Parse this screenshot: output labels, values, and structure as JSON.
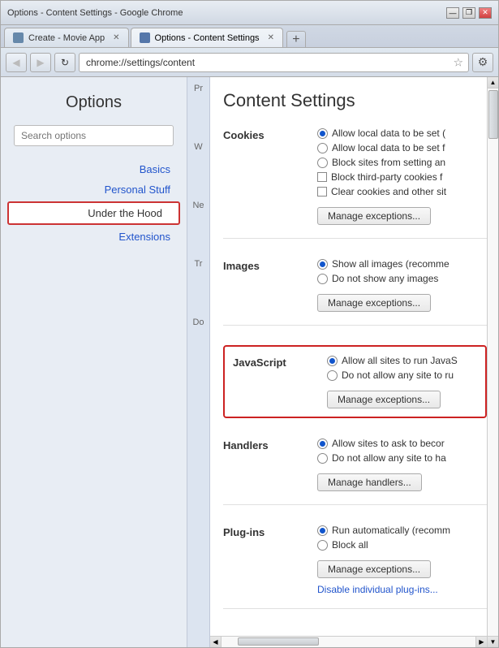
{
  "browser": {
    "tabs": [
      {
        "id": "tab1",
        "title": "Create - Movie App",
        "active": false,
        "icon": "movie-icon"
      },
      {
        "id": "tab2",
        "title": "Options - Content Settings",
        "active": true,
        "icon": "settings-icon"
      }
    ],
    "new_tab_label": "+",
    "address": "chrome://settings/content",
    "nav_back": "◀",
    "nav_forward": "▶",
    "nav_refresh": "↻",
    "star_icon": "☆",
    "wrench_icon": "🔧",
    "min_btn": "—",
    "restore_btn": "❐",
    "close_btn": "✕",
    "title_bar_title": "Options - Content Settings - Google Chrome"
  },
  "sidebar": {
    "title": "Options",
    "search_placeholder": "Search options",
    "links": [
      {
        "id": "basics",
        "label": "Basics",
        "active": false
      },
      {
        "id": "personal-stuff",
        "label": "Personal Stuff",
        "active": false
      },
      {
        "id": "under-the-hood",
        "label": "Under the Hood",
        "active": true
      },
      {
        "id": "extensions",
        "label": "Extensions",
        "active": false
      }
    ],
    "section_labels": [
      "Pr",
      "W\nCo",
      "Ne",
      "Tr",
      "Do"
    ]
  },
  "content": {
    "title": "Content Settings",
    "sections": [
      {
        "id": "cookies",
        "label": "Cookies",
        "options": [
          {
            "type": "radio",
            "selected": true,
            "text": "Allow local data to be set ("
          },
          {
            "type": "radio",
            "selected": false,
            "text": "Allow local data to be set f"
          },
          {
            "type": "radio",
            "selected": false,
            "text": "Block sites from setting an"
          },
          {
            "type": "checkbox",
            "checked": false,
            "text": "Block third-party cookies f"
          },
          {
            "type": "checkbox",
            "checked": false,
            "text": "Clear cookies and other sit"
          }
        ],
        "button": "Manage exceptions..."
      },
      {
        "id": "images",
        "label": "Images",
        "options": [
          {
            "type": "radio",
            "selected": true,
            "text": "Show all images (recomme"
          },
          {
            "type": "radio",
            "selected": false,
            "text": "Do not show any images"
          }
        ],
        "button": "Manage exceptions..."
      },
      {
        "id": "javascript",
        "label": "JavaScript",
        "highlighted": true,
        "options": [
          {
            "type": "radio",
            "selected": true,
            "text": "Allow all sites to run JavaS"
          },
          {
            "type": "radio",
            "selected": false,
            "text": "Do not allow any site to ru"
          }
        ],
        "button": "Manage exceptions..."
      },
      {
        "id": "handlers",
        "label": "Handlers",
        "options": [
          {
            "type": "radio",
            "selected": true,
            "text": "Allow sites to ask to becor"
          },
          {
            "type": "radio",
            "selected": false,
            "text": "Do not allow any site to ha"
          }
        ],
        "button": "Manage handlers..."
      },
      {
        "id": "plugins",
        "label": "Plug-ins",
        "options": [
          {
            "type": "radio",
            "selected": true,
            "text": "Run automatically (recomm"
          },
          {
            "type": "radio",
            "selected": false,
            "text": "Block all"
          }
        ],
        "button": "Manage exceptions...",
        "link": "Disable individual plug-ins..."
      }
    ]
  }
}
